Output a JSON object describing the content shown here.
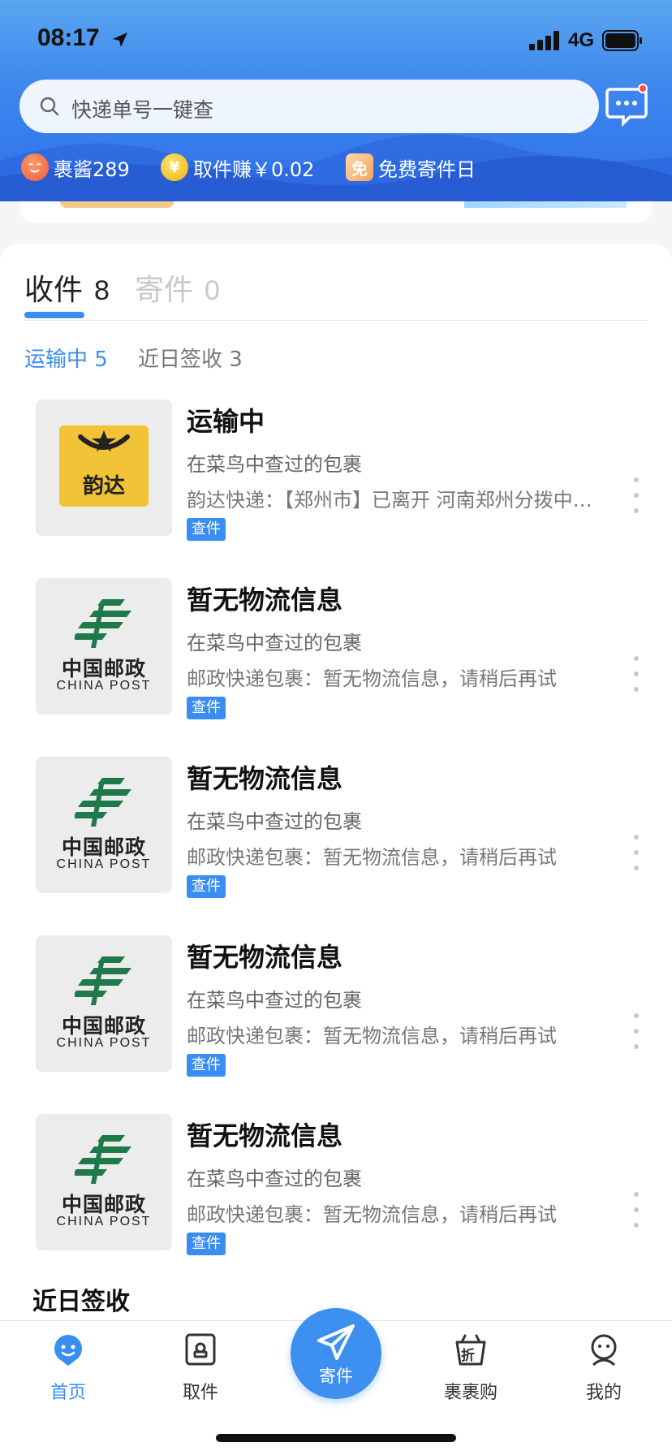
{
  "status_bar": {
    "time": "08:17",
    "network": "4G"
  },
  "search": {
    "placeholder": "快递单号一键查"
  },
  "perks": [
    {
      "label": "裹酱289",
      "icon": "mascot-icon"
    },
    {
      "label": "取件赚￥0.02",
      "icon": "coin-icon",
      "glyph": "¥"
    },
    {
      "label": "免费寄件日",
      "icon": "free-icon",
      "glyph": "免"
    }
  ],
  "tabs": {
    "receive": {
      "label": "收件",
      "count": "8"
    },
    "send": {
      "label": "寄件",
      "count": "0"
    }
  },
  "subtabs": {
    "in_transit": "运输中 5",
    "recent_signed": "近日签收 3"
  },
  "packages": [
    {
      "carrier": "yunda",
      "logo_text": "韵达",
      "title": "运输中",
      "source": "在菜鸟中查过的包裹",
      "detail": "韵达快递：【郑州市】已离开 河南郑州分拨中心；发往 河南郑州",
      "tag": "查件"
    },
    {
      "carrier": "china-post",
      "logo_cn": "中国邮政",
      "logo_en": "CHINA POST",
      "title": "暂无物流信息",
      "source": "在菜鸟中查过的包裹",
      "detail": "邮政快递包裹：暂无物流信息，请稍后再试",
      "tag": "查件"
    },
    {
      "carrier": "china-post",
      "logo_cn": "中国邮政",
      "logo_en": "CHINA POST",
      "title": "暂无物流信息",
      "source": "在菜鸟中查过的包裹",
      "detail": "邮政快递包裹：暂无物流信息，请稍后再试",
      "tag": "查件"
    },
    {
      "carrier": "china-post",
      "logo_cn": "中国邮政",
      "logo_en": "CHINA POST",
      "title": "暂无物流信息",
      "source": "在菜鸟中查过的包裹",
      "detail": "邮政快递包裹：暂无物流信息，请稍后再试",
      "tag": "查件"
    },
    {
      "carrier": "china-post",
      "logo_cn": "中国邮政",
      "logo_en": "CHINA POST",
      "title": "暂无物流信息",
      "source": "在菜鸟中查过的包裹",
      "detail": "邮政快递包裹：暂无物流信息，请稍后再试",
      "tag": "查件"
    }
  ],
  "recent_heading": "近日签收",
  "bottom_nav": {
    "home": "首页",
    "pickup": "取件",
    "send": "寄件",
    "shop": "裹裹购",
    "shop_glyph": "折",
    "me": "我的"
  },
  "colors": {
    "accent": "#3a8ef2",
    "header_top": "#5aa6f0",
    "header_bottom": "#2f6fea",
    "yunda_yellow": "#f2c237",
    "post_green": "#1f7a4a",
    "tag_blue": "#3a8ef2"
  }
}
